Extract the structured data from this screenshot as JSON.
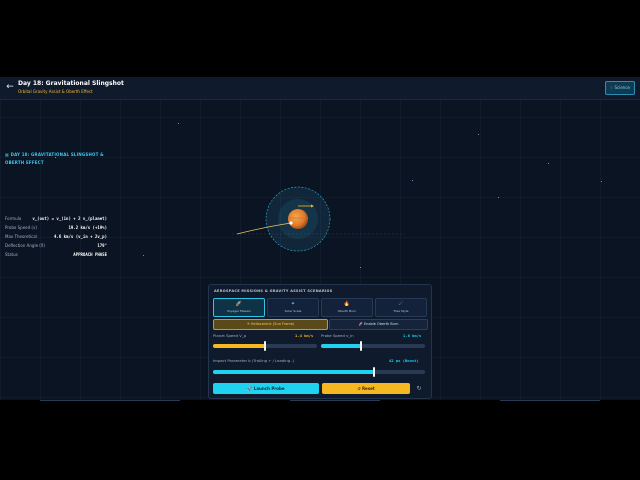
{
  "header": {
    "back_icon": "arrow-left-icon",
    "title": "Day 18: Gravitational Slingshot",
    "subtitle": "Orbital Gravity Assist & Oberth Effect",
    "badge": "Science",
    "badge_icon": "lightbulb-icon"
  },
  "info": {
    "title": "DAY 18: GRAVITATIONAL SLINGSHOT & OBERTH EFFECT",
    "rows": [
      {
        "key": "Formula",
        "value": "v_(out) = v_(in) + 2 v_(planet)"
      },
      {
        "key": "Probe Speed (v)",
        "value": "19.2 km/s (+19%)"
      },
      {
        "key": "Max Theoretical",
        "value": "4.6 km/s (v_in + 2v_p)"
      },
      {
        "key": "Deflection Angle (δ)",
        "value": "179°"
      },
      {
        "key": "Status",
        "value": "APPROACH PHASE"
      }
    ]
  },
  "panel": {
    "title": "AEROSPACE MISSIONS & GRAVITY ASSIST SCENARIOS",
    "scenarios": [
      {
        "label": "Voyager Mission",
        "icon": "🚀",
        "icon_name": "rocket-icon",
        "active": true
      },
      {
        "label": "Solar Scale",
        "icon": "✦",
        "icon_name": "sparkle-icon",
        "active": false
      },
      {
        "label": "Oberth Burn",
        "icon": "🔥",
        "icon_name": "flame-icon",
        "active": false
      },
      {
        "label": "Free Style",
        "icon": "☄",
        "icon_name": "comet-icon",
        "active": false
      }
    ],
    "frame_heliocentric": "☀ Heliocentric (Sun Frame)",
    "frame_oberth": "🚀 Enable Oberth Burn",
    "planet_speed_label": "Planet Speed V_p",
    "planet_speed_value": "1.4 km/s",
    "planet_speed_fraction": 0.5,
    "probe_speed_label": "Probe Speed v_in",
    "probe_speed_value": "1.6 km/s",
    "probe_speed_fraction": 0.38,
    "impact_label": "Impact Parameter b (Trailing + / Leading -)",
    "impact_value": "42 px (Boost)",
    "impact_fraction": 0.76,
    "launch_label": "🚀 Launch Probe",
    "reset_label": "↺ Reset",
    "reload_icon": "refresh-icon"
  },
  "colors": {
    "accent_cyan": "#1fd3f0",
    "accent_orange": "#f5b820",
    "planet": "#e07a2a"
  }
}
